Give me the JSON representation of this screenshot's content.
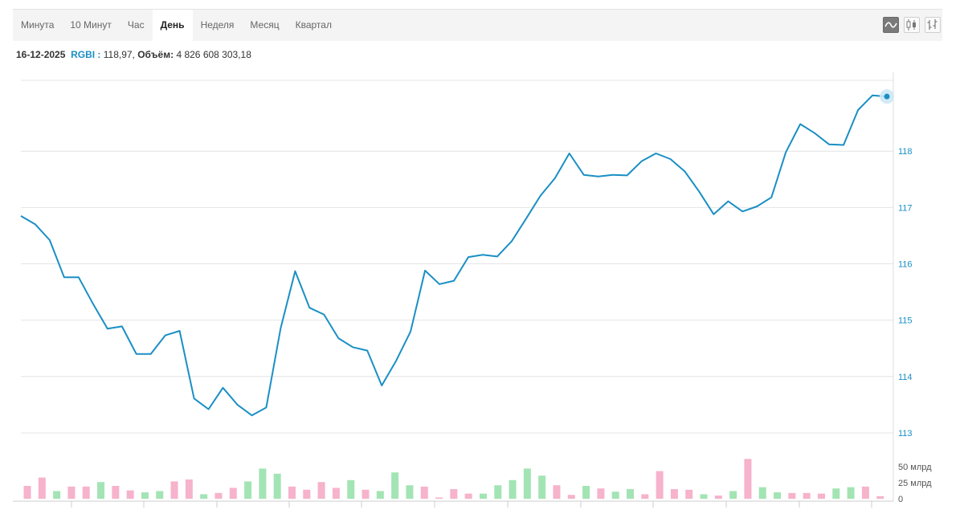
{
  "tabs": [
    {
      "label": "Минута",
      "active": false
    },
    {
      "label": "10 Минут",
      "active": false
    },
    {
      "label": "Час",
      "active": false
    },
    {
      "label": "День",
      "active": true
    },
    {
      "label": "Неделя",
      "active": false
    },
    {
      "label": "Месяц",
      "active": false
    },
    {
      "label": "Квартал",
      "active": false
    }
  ],
  "chart_types": [
    {
      "icon": "line-chart-icon",
      "active": true
    },
    {
      "icon": "candlestick-chart-icon",
      "active": false
    },
    {
      "icon": "ohlc-bar-chart-icon",
      "active": false
    }
  ],
  "info": {
    "date": "16-12-2025",
    "ticker": "RGBI",
    "price_sep": " : ",
    "price": "118,97",
    "volume_label": "Объём",
    "volume": "4 826 608 303,18"
  },
  "colors": {
    "line": "#1a8fc4",
    "vol_up": "#a3e4b4",
    "vol_down": "#f6b3cb",
    "axis_label": "#1a8fc4",
    "grid": "#e4e4e4"
  },
  "chart_data": [
    {
      "type": "line",
      "series": [
        {
          "values": [
            116.85,
            116.7,
            116.42,
            115.76,
            115.76,
            115.29,
            114.85,
            114.89,
            114.4,
            114.4,
            114.73,
            114.81,
            113.61,
            113.42,
            113.8,
            113.5,
            113.31,
            113.45,
            114.86,
            115.87,
            115.22,
            115.1,
            114.68,
            114.52,
            114.46,
            113.84,
            114.28,
            114.8,
            115.88,
            115.64,
            115.7,
            116.12,
            116.16,
            116.13,
            116.4,
            116.8,
            117.21,
            117.52,
            117.96,
            117.58,
            117.55,
            117.58,
            117.57,
            117.82,
            117.96,
            117.86,
            117.64,
            117.28,
            116.88,
            117.11,
            116.93,
            117.02,
            117.18,
            117.98,
            118.48,
            118.32,
            118.12,
            118.11,
            118.73,
            118.99,
            118.97
          ]
        }
      ],
      "ylim": [
        112.7,
        119.4
      ],
      "yticks": [
        "113",
        "114",
        "115",
        "116",
        "117",
        "118"
      ],
      "grid": true,
      "legend": false
    },
    {
      "type": "bar",
      "values": [
        20,
        33,
        12,
        19,
        19,
        26,
        20,
        13,
        10,
        12,
        27,
        30,
        7,
        9,
        17,
        27,
        47,
        39,
        19,
        14,
        26,
        17,
        29,
        14,
        12,
        41,
        21,
        19,
        2,
        15,
        8,
        8,
        21,
        29,
        47,
        36,
        21,
        6,
        20,
        16,
        11,
        15,
        7,
        43,
        15,
        14,
        7,
        5,
        12,
        62,
        18,
        10,
        9,
        9,
        8,
        16,
        18,
        19,
        4
      ],
      "direction": [
        "down",
        "down",
        "up",
        "down",
        "down",
        "up",
        "down",
        "down",
        "up",
        "up",
        "down",
        "down",
        "up",
        "down",
        "down",
        "up",
        "up",
        "up",
        "down",
        "down",
        "down",
        "down",
        "up",
        "down",
        "up",
        "up",
        "up",
        "down",
        "down",
        "down",
        "down",
        "up",
        "up",
        "up",
        "up",
        "up",
        "down",
        "down",
        "up",
        "down",
        "up",
        "up",
        "down",
        "down",
        "down",
        "down",
        "up",
        "down",
        "up",
        "down",
        "up",
        "up",
        "down",
        "down",
        "down",
        "up",
        "up",
        "down",
        "down"
      ],
      "ylim": [
        0,
        70
      ],
      "yticks": [
        "0",
        "25 млрд",
        "50 млрд"
      ]
    }
  ]
}
